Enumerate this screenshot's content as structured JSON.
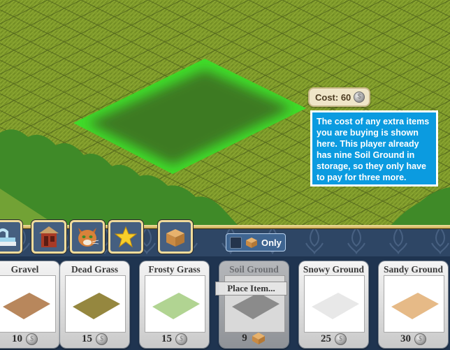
{
  "world": {
    "cost_badge": {
      "label": "Cost: 60",
      "currency_icon": "silver-coin-icon"
    },
    "tooltip_callout": "The cost of any extra items you are buying is shown here. This player already has nine Soil Ground in storage, so they only have to pay for three more.",
    "colors": {
      "grass": "#7f9a2a",
      "placement_highlight": "#3fdc2a",
      "placed_turf": "#3f7a22",
      "hedge": "#3f8a28",
      "callout": "#0b9be0"
    }
  },
  "toolbar": {
    "categories": [
      {
        "name": "fountains",
        "icon": "fountain-icon"
      },
      {
        "name": "buildings",
        "icon": "gazebo-icon"
      },
      {
        "name": "pets",
        "icon": "cat-icon"
      },
      {
        "name": "specials",
        "icon": "star-icon"
      },
      {
        "name": "storage",
        "icon": "box-icon"
      }
    ],
    "storage_only_toggle": {
      "label": "Only",
      "checked": false,
      "icon": "box-icon"
    }
  },
  "items": [
    {
      "name": "Gravel",
      "price": "10",
      "price_icon": "silver-coin-icon",
      "swatch": "#b07a4a"
    },
    {
      "name": "Dead Grass",
      "price": "15",
      "price_icon": "silver-coin-icon",
      "swatch": "#8a7a2a"
    },
    {
      "name": "Frosty Grass",
      "price": "15",
      "price_icon": "silver-coin-icon",
      "swatch": "#a9cf86"
    },
    {
      "name": "Soil Ground",
      "price": "9",
      "price_icon": "box-icon",
      "swatch": "#6a6a6a",
      "selected": true,
      "action": "Place Item..."
    },
    {
      "name": "Snowy Ground",
      "price": "25",
      "price_icon": "silver-coin-icon",
      "swatch": "#e6e6e6"
    },
    {
      "name": "Sandy Ground",
      "price": "30",
      "price_icon": "silver-coin-icon",
      "swatch": "#e3b27a"
    }
  ]
}
